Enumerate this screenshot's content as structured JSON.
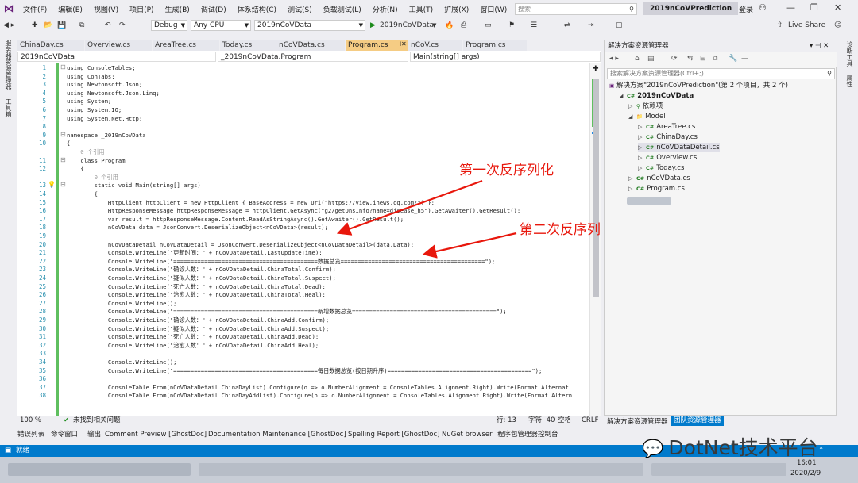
{
  "menu": [
    "文件(F)",
    "编辑(E)",
    "视图(V)",
    "项目(P)",
    "生成(B)",
    "调试(D)",
    "体系结构(C)",
    "测试(S)",
    "负载测试(L)",
    "分析(N)",
    "工具(T)",
    "扩展(X)",
    "窗口(W)",
    "帮助(H)"
  ],
  "search_placeholder": "搜索",
  "solution_title": "2019nCoVPrediction",
  "login": "登录",
  "toolbar": {
    "config": "Debug",
    "platform": "Any CPU",
    "project": "2019nCoVData",
    "run": "2019nCoVData",
    "live_share": "Live Share"
  },
  "left_strip": [
    "服务器资源管理器",
    "工具箱"
  ],
  "right_strip": [
    "诊断工具",
    "属性"
  ],
  "tabs": [
    "ChinaDay.cs",
    "Overview.cs",
    "AreaTree.cs",
    "Today.cs",
    "nCoVData.cs",
    "Program.cs",
    "nCoV.cs",
    "Program.cs"
  ],
  "nav": {
    "project": "2019nCoVData",
    "class": "_2019nCoVData.Program",
    "member": "Main(string[] args)"
  },
  "code_lines": [
    {
      "n": "1",
      "t": "using ConsoleTables;"
    },
    {
      "n": "2",
      "t": "using ConTabs;"
    },
    {
      "n": "3",
      "t": "using Newtonsoft.Json;"
    },
    {
      "n": "4",
      "t": "using Newtonsoft.Json.Linq;"
    },
    {
      "n": "5",
      "t": "using System;"
    },
    {
      "n": "6",
      "t": "using System.IO;"
    },
    {
      "n": "7",
      "t": "using System.Net.Http;"
    },
    {
      "n": "8",
      "t": ""
    },
    {
      "n": "9",
      "t": "namespace _2019nCoVData"
    },
    {
      "n": "10",
      "t": "{"
    },
    {
      "n": "",
      "t": "    0 个引用"
    },
    {
      "n": "11",
      "t": "    class Program"
    },
    {
      "n": "12",
      "t": "    {"
    },
    {
      "n": "",
      "t": "        0 个引用"
    },
    {
      "n": "13",
      "t": "        static void Main(string[] args)"
    },
    {
      "n": "14",
      "t": "        {"
    },
    {
      "n": "15",
      "t": "            HttpClient httpClient = new HttpClient { BaseAddress = new Uri(\"https://view.inews.qq.com/\") };"
    },
    {
      "n": "16",
      "t": "            HttpResponseMessage httpResponseMessage = httpClient.GetAsync(\"g2/getOnsInfo?name=disease_h5\").GetAwaiter().GetResult();"
    },
    {
      "n": "17",
      "t": "            var result = httpResponseMessage.Content.ReadAsStringAsync().GetAwaiter().GetResult();"
    },
    {
      "n": "18",
      "t": "            nCoVData data = JsonConvert.DeserializeObject<nCoVData>(result);"
    },
    {
      "n": "19",
      "t": ""
    },
    {
      "n": "20",
      "t": "            nCoVDataDetail nCoVDataDetail = JsonConvert.DeserializeObject<nCoVDataDetail>(data.Data);"
    },
    {
      "n": "21",
      "t": "            Console.WriteLine(\"更新时间：\" + nCoVDataDetail.LastUpdateTime);"
    },
    {
      "n": "22",
      "t": "            Console.WriteLine(\"==========================================数据总览==========================================\");"
    },
    {
      "n": "23",
      "t": "            Console.WriteLine(\"确诊人数：\" + nCoVDataDetail.ChinaTotal.Confirm);"
    },
    {
      "n": "24",
      "t": "            Console.WriteLine(\"疑似人数：\" + nCoVDataDetail.ChinaTotal.Suspect);"
    },
    {
      "n": "25",
      "t": "            Console.WriteLine(\"死亡人数：\" + nCoVDataDetail.ChinaTotal.Dead);"
    },
    {
      "n": "26",
      "t": "            Console.WriteLine(\"治愈人数：\" + nCoVDataDetail.ChinaTotal.Heal);"
    },
    {
      "n": "27",
      "t": "            Console.WriteLine();"
    },
    {
      "n": "28",
      "t": "            Console.WriteLine(\"==========================================新增数据总览==========================================\");"
    },
    {
      "n": "29",
      "t": "            Console.WriteLine(\"确诊人数：\" + nCoVDataDetail.ChinaAdd.Confirm);"
    },
    {
      "n": "30",
      "t": "            Console.WriteLine(\"疑似人数：\" + nCoVDataDetail.ChinaAdd.Suspect);"
    },
    {
      "n": "31",
      "t": "            Console.WriteLine(\"死亡人数：\" + nCoVDataDetail.ChinaAdd.Dead);"
    },
    {
      "n": "32",
      "t": "            Console.WriteLine(\"治愈人数：\" + nCoVDataDetail.ChinaAdd.Heal);"
    },
    {
      "n": "33",
      "t": ""
    },
    {
      "n": "34",
      "t": "            Console.WriteLine();"
    },
    {
      "n": "35",
      "t": "            Console.WriteLine(\"==========================================每日数据总览(按日期升序)==========================================\");"
    },
    {
      "n": "36",
      "t": ""
    },
    {
      "n": "37",
      "t": "            ConsoleTable.From(nCoVDataDetail.ChinaDayList).Configure(o => o.NumberAlignment = ConsoleTables.Alignment.Right).Write(Format.Alternat"
    },
    {
      "n": "38",
      "t": "            ConsoleTable.From(nCoVDataDetail.ChinaDayAddList).Configure(o => o.NumberAlignment = ConsoleTables.Alignment.Right).Write(Format.Altern"
    }
  ],
  "annotations": {
    "first": "第一次反序列化",
    "second": "第二次反序列化"
  },
  "editor_status": {
    "zoom": "100 %",
    "issues": "未找到相关问题",
    "line": "行: 13",
    "col": "字符: 40",
    "space": "空格",
    "eol": "CRLF"
  },
  "solution_panel": {
    "title": "解决方案资源管理器",
    "search": "搜索解决方案资源管理器(Ctrl+;)",
    "root": "解决方案\"2019nCoVPrediction\"(第 2 个项目，共 2 个)",
    "items": [
      {
        "label": "2019nCoVData",
        "level": 1,
        "cs": false,
        "bold": true
      },
      {
        "label": "依赖项",
        "level": 2,
        "cs": false
      },
      {
        "label": "Model",
        "level": 2,
        "cs": false
      },
      {
        "label": "AreaTree.cs",
        "level": 3,
        "cs": true
      },
      {
        "label": "ChinaDay.cs",
        "level": 3,
        "cs": true
      },
      {
        "label": "nCoVDataDetail.cs",
        "level": 3,
        "cs": true
      },
      {
        "label": "Overview.cs",
        "level": 3,
        "cs": true
      },
      {
        "label": "Today.cs",
        "level": 3,
        "cs": true
      },
      {
        "label": "nCoVData.cs",
        "level": 2,
        "cs": true
      },
      {
        "label": "Program.cs",
        "level": 2,
        "cs": true
      }
    ],
    "tabs": [
      "解决方案资源管理器",
      "团队资源管理器"
    ]
  },
  "bottom_tabs": [
    "错误列表",
    "命令窗口",
    "输出",
    "Comment Preview [GhostDoc]",
    "Documentation Maintenance [GhostDoc]",
    "Spelling Report [GhostDoc]",
    "NuGet browser",
    "程序包管理器控制台"
  ],
  "status_bar": {
    "ready": "就绪"
  },
  "watermark": "DotNet技术平台",
  "taskbar": {
    "time": "16:01",
    "date": "2020/2/9"
  }
}
